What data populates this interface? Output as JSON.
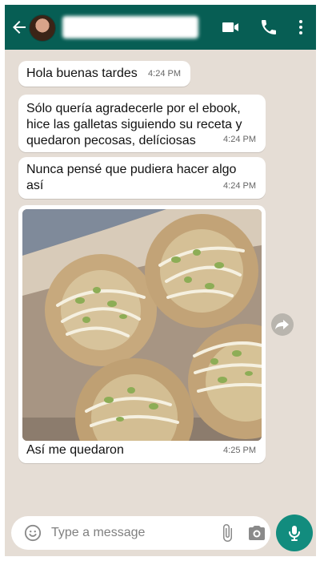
{
  "header": {
    "back_icon": "arrow-back-icon",
    "video_icon": "video-call-icon",
    "call_icon": "phone-icon",
    "menu_icon": "more-vert-icon",
    "accent": "#075e54"
  },
  "messages": [
    {
      "text": "Hola buenas tardes",
      "time": "4:24 PM"
    },
    {
      "text": "Sólo quería agradecerle por el ebook, hice las galletas siguiendo su receta y quedaron pecosas, delíciosas",
      "time": "4:24 PM"
    },
    {
      "text": "Nunca pensé que pudiera hacer algo así",
      "time": "4:24 PM"
    },
    {
      "text": "Así me quedaron",
      "time": "4:25 PM",
      "image": "photo-cookies-image"
    }
  ],
  "input": {
    "placeholder": "Type a message",
    "emoji_icon": "emoji-icon",
    "attach_icon": "paperclip-icon",
    "camera_icon": "camera-icon",
    "mic_icon": "mic-icon",
    "mic_color": "#128c7e"
  },
  "forward_icon": "forward-icon"
}
